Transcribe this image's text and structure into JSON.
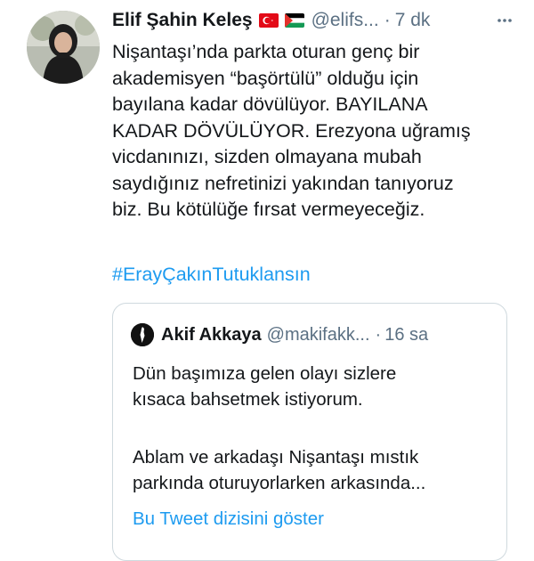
{
  "tweet": {
    "author_name": "Elif Şahin Keleş",
    "flags": [
      "turkey-flag",
      "palestine-flag"
    ],
    "handle": "@elifs...",
    "separator": "·",
    "time": "7 dk",
    "text_lines": [
      "Nişantaşı’nda parkta oturan genç bir",
      "akademisyen “başörtülü” olduğu için",
      "bayılana kadar dövülüyor. BAYILANA",
      "KADAR DÖVÜLÜYOR. Erezyona uğramış",
      "vicdanınızı, sizden olmayana mubah",
      "saydığınız nefretinizi yakından tanıyoruz",
      "biz. Bu kötülüğe fırsat vermeyeceğiz."
    ],
    "hashtag": "#ErayÇakınTutuklansın"
  },
  "quoted_tweet": {
    "author_name": "Akif Akkaya",
    "handle": "@makifakk...",
    "separator": "·",
    "time": "16 sa",
    "text_lines_1": [
      "Dün başımıza gelen olayı sizlere",
      "kısaca bahsetmek istiyorum."
    ],
    "text_lines_2": [
      "Ablam ve arkadaşı Nişantaşı mıstık",
      "parkında oturuyorlarken arkasında..."
    ],
    "show_thread_label": "Bu Tweet dizisini göster"
  },
  "colors": {
    "text": "#14171a",
    "secondary": "#5b7083",
    "link": "#1d9bf0",
    "border": "#cfd9de"
  },
  "icons": {
    "more": "more-dots-icon"
  }
}
